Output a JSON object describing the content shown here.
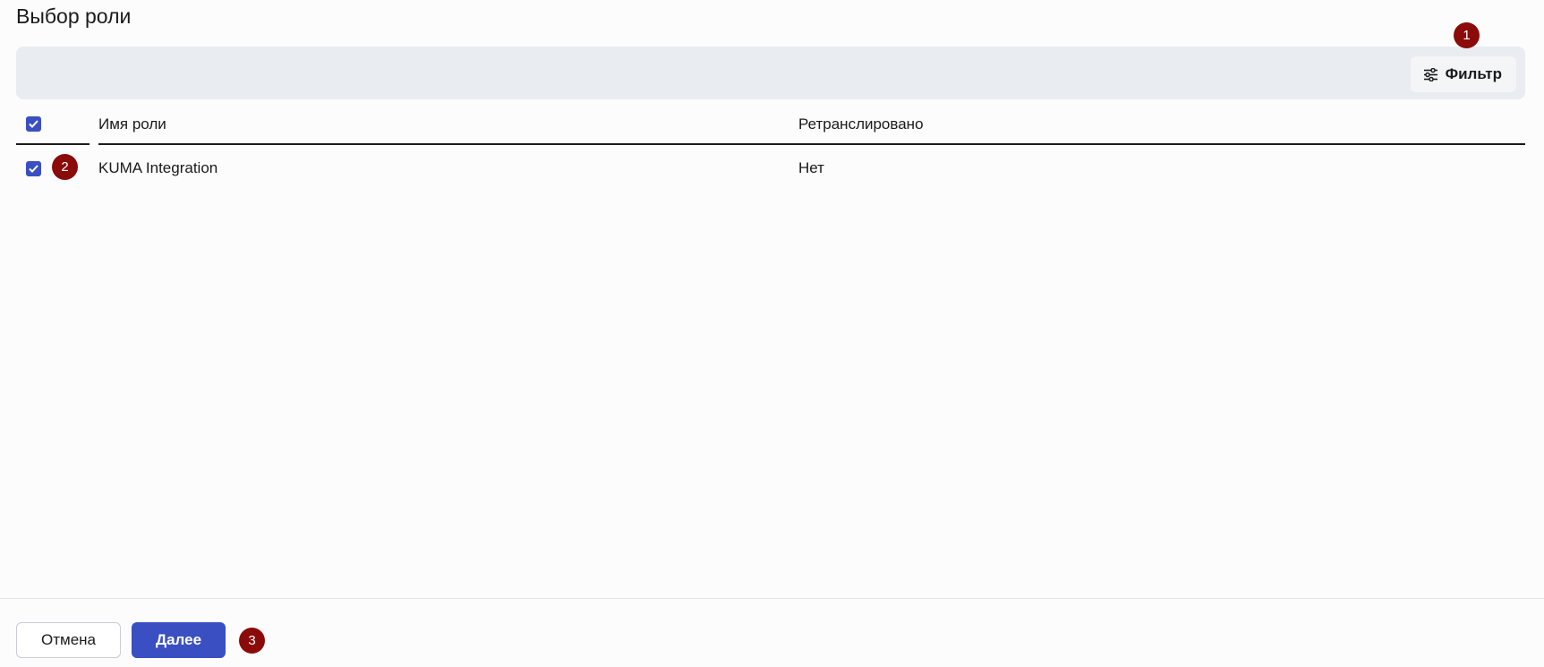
{
  "page": {
    "title": "Выбор роли"
  },
  "toolbar": {
    "filter_label": "Фильтр"
  },
  "table": {
    "columns": {
      "name": "Имя роли",
      "relayed": "Ретранслировано"
    },
    "rows": [
      {
        "name": "KUMA Integration",
        "relayed": "Нет",
        "checked": true
      }
    ],
    "select_all_checked": true
  },
  "footer": {
    "cancel_label": "Отмена",
    "next_label": "Далее"
  },
  "annotations": {
    "badge1": "1",
    "badge2": "2",
    "badge3": "3"
  },
  "colors": {
    "accent": "#3a4fc1",
    "badge": "#8b0a0a"
  }
}
